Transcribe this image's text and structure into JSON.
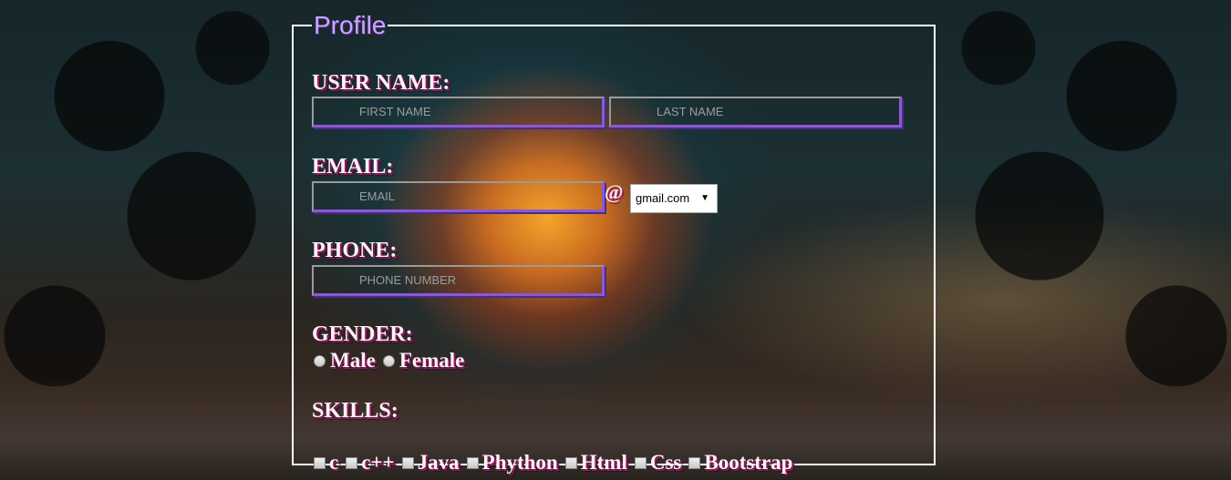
{
  "form": {
    "legend": "Profile",
    "username": {
      "label": "USER NAME:",
      "first_placeholder": "FIRST NAME",
      "last_placeholder": "LAST NAME"
    },
    "email": {
      "label": "EMAIL:",
      "placeholder": "EMAIL",
      "at": "@",
      "domain_selected": "gmail.com"
    },
    "phone": {
      "label": "PHONE:",
      "placeholder": "PHONE NUMBER"
    },
    "gender": {
      "label": "GENDER:",
      "options": [
        "Male",
        "Female"
      ]
    },
    "skills": {
      "label": "SKILLS:",
      "options": [
        "c",
        "c++",
        "Java",
        "Phython",
        "Html",
        "Css",
        "Bootstrap"
      ]
    }
  },
  "colors": {
    "legend": "#c9a6ff",
    "label_text": "#fff2f6",
    "label_shadow": "#8a1d5e",
    "input_border_accent": "#8a5ad0"
  }
}
